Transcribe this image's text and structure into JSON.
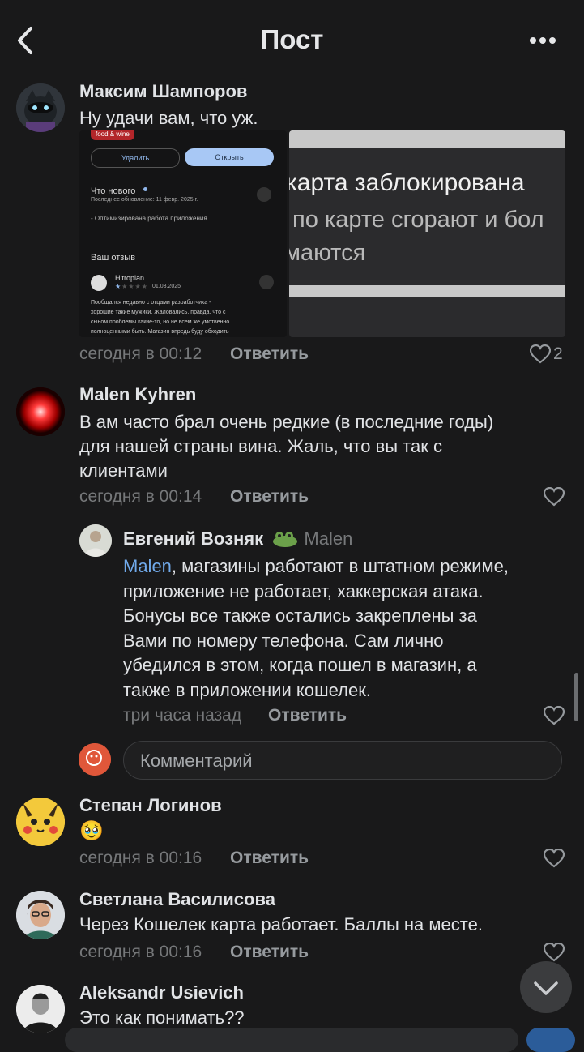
{
  "header": {
    "title": "Пост"
  },
  "comments": [
    {
      "author": "Максим Шампоров",
      "text": "Ну удачи вам, что уж.",
      "time": "сегодня в 00:12",
      "reply_label": "Ответить",
      "likes": "2",
      "attachments": {
        "screenshot_app": {
          "tag": "food & wine",
          "delete": "Удалить",
          "open": "Открыть",
          "whats_new": "Что нового",
          "updated": "Последнее обновление: 11 февр. 2025 г.",
          "change": "- Оптимизирована работа приложения",
          "your_review": "Ваш отзыв",
          "reviewer": "Hitroplan",
          "review_date": "01.03.2025",
          "review_text_1": "Пообщался недавно с отцами разработчика -",
          "review_text_2": "хорошие такие мужики. Жаловались, правда, что с",
          "review_text_3": "сыном проблемы какие-то, но не всем же умственно",
          "review_text_4": "полноценными быть. Магазин впредь буду обходить"
        },
        "screenshot_message": {
          "line1": "карта заблокирована",
          "line2": "по карте сгорают и бол",
          "line3": "маются"
        }
      }
    },
    {
      "author": "Malen Kyhren",
      "text_lines": [
        "В ам часто брал очень редкие (в последние годы)",
        "для нашей страны вина. Жаль, что вы так с",
        "клиентами"
      ],
      "time": "сегодня в 00:14",
      "reply_label": "Ответить"
    },
    {
      "author": "Евгений Возняк",
      "reply_to": "Malen",
      "mention": "Malen",
      "text_lines": [
        ", магазины работают в штатном режиме,",
        "приложение не работает, хаккерская атака.",
        "Бонусы все также остались закреплены за",
        "Вами по номеру телефона. Сам лично",
        "убедился в этом, когда пошел в магазин, а",
        "также в приложении кошелек."
      ],
      "time": "три часа назад",
      "reply_label": "Ответить"
    },
    {
      "author": "Степан Логинов",
      "text": "🥹",
      "time": "сегодня в 00:16",
      "reply_label": "Ответить"
    },
    {
      "author": "Светлана Василисова",
      "text": "Через Кошелек карта работает. Баллы на месте.",
      "time": "сегодня в 00:16",
      "reply_label": "Ответить"
    },
    {
      "author": "Aleksandr Usievich",
      "text": "Это как понимать??"
    }
  ],
  "comment_input": {
    "placeholder": "Комментарий"
  },
  "colors": {
    "background": "#19191a",
    "link": "#71aaeb",
    "open_button": "#a8c8f5"
  },
  "icons": [
    "back-icon",
    "more-icon",
    "heart-icon",
    "chevron-down-icon"
  ]
}
